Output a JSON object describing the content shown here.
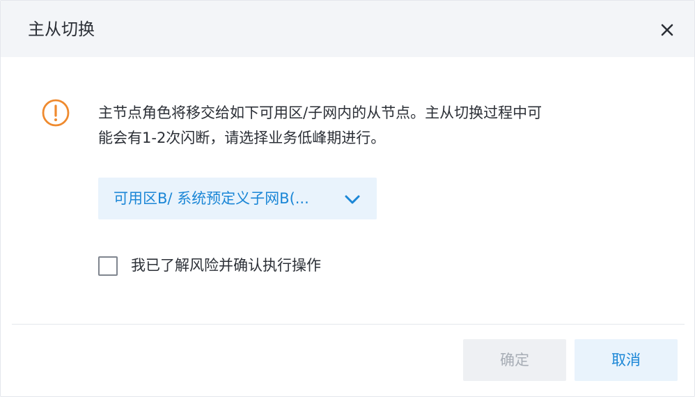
{
  "dialog": {
    "title": "主从切换",
    "close_icon": "close-icon",
    "warning_icon": "warning-circle-icon",
    "message_line1": "主节点角色将移交给如下可用区/子网内的从节点。主从切换过程中可",
    "message_line2": "能会有1-2次闪断，请选择业务低峰期进行。",
    "zone_select": {
      "value": "可用区B/ 系统预定义子网B(...",
      "icon": "chevron-down-icon"
    },
    "confirm_checkbox": {
      "checked": false,
      "label": "我已了解风险并确认执行操作"
    },
    "buttons": {
      "ok_label": "确定",
      "ok_disabled": true,
      "cancel_label": "取消"
    }
  },
  "colors": {
    "header_bg": "#f3f5f8",
    "accent_blue": "#1a86d6",
    "accent_blue_bg": "#e9f3fc",
    "warning_orange": "#ef8a2e",
    "disabled_text": "#a7adb5",
    "disabled_bg": "#eef0f3",
    "text": "#2b2f36"
  }
}
